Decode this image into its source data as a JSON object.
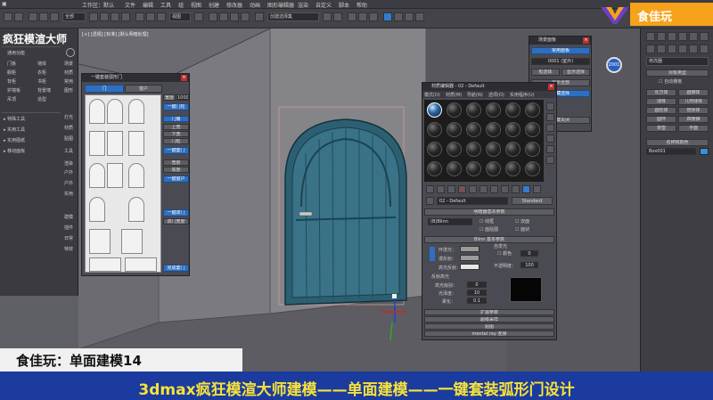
{
  "app": {
    "window_title": "工作区：默认",
    "menus": [
      "文件",
      "编辑",
      "工具",
      "组",
      "视图",
      "创建",
      "修改器",
      "动画",
      "图形编辑器",
      "渲染",
      "自定义",
      "脚本",
      "帮助"
    ],
    "selection_dropdown": "全部",
    "view_dropdown": "视图",
    "named_selection": "创建选择集"
  },
  "brand": {
    "text": "食佳玩"
  },
  "left_panel": {
    "title": "疯狂模渲大师",
    "items": [
      {
        "label": "通用功能",
        "col2": ""
      },
      {
        "label": "门板",
        "col2": "墙体"
      },
      {
        "label": "橱柜",
        "col2": "衣柜"
      },
      {
        "label": "背柜",
        "col2": "书柜"
      },
      {
        "label": "护墙板",
        "col2": "背景墙"
      },
      {
        "label": "吊顶",
        "col2": "造型"
      },
      {
        "label": "特殊工具",
        "col2": ""
      },
      {
        "label": "实用工具",
        "col2": ""
      },
      {
        "label": "实用图纸",
        "col2": ""
      },
      {
        "label": "移动面板",
        "col2": ""
      }
    ],
    "side_tabs": [
      "场景",
      "材质",
      "常用",
      "图形",
      "灯光",
      "材质",
      "贴图",
      "工具",
      "渲染",
      "户外",
      "户外",
      "实用",
      "建模",
      "插件",
      "日常",
      "特效"
    ]
  },
  "viewport": {
    "label": "[+] [透视] [标准] [默认明暗处理]"
  },
  "door_library": {
    "title": "一键套装弧形门",
    "tabs": [
      "门",
      "窗户"
    ],
    "side_labels": [
      "宽度",
      "1000",
      "一键门柱",
      "门扇",
      "上宽",
      "下宽",
      "门框",
      "一键套门",
      "宽度",
      "高度",
      "一键窗户",
      "一键双门",
      "双门宽度",
      "一键套门",
      "完成套门"
    ]
  },
  "material_editor": {
    "title": "材质编辑器 - 02 - Default",
    "menu": [
      "模式(D)",
      "材质(M)",
      "导航(N)",
      "选项(O)",
      "实用程序(U)"
    ],
    "material_name": "02 - Default",
    "material_type": "Standard",
    "rollouts": [
      "明暗器基本参数",
      "Blinn 基本参数",
      "扩展参数",
      "超级采样",
      "贴图",
      "mental ray 连接"
    ],
    "shader": "(B)Blinn",
    "options": [
      "线框",
      "双面",
      "面贴图",
      "面状"
    ],
    "params": {
      "ambient_label": "环境光：",
      "diffuse_label": "漫反射：",
      "specular_label": "高光反射：",
      "self_illum_label": "自发光",
      "color_label": "颜色",
      "color_value": "0",
      "opacity_label": "不透明度：",
      "opacity_value": "100",
      "specular_highlights": "反射高光",
      "spec_level_label": "高光级别：",
      "spec_level_value": "0",
      "glossiness_label": "光泽度：",
      "glossiness_value": "10",
      "soften_label": "柔化：",
      "soften_value": "0.1"
    }
  },
  "scene_panel": {
    "title": "场景面板",
    "label1": "常用面板",
    "field": "0001 (室外)",
    "buttons": [
      "框选体",
      "显示选择",
      "显示全部",
      "隐藏选择",
      "隐藏关闭"
    ],
    "badge": "2001"
  },
  "command_panel": {
    "dropdown": "修改器",
    "rollout_title": "对象类型",
    "auto_grid": "自动栅格",
    "object_types": [
      "长方体",
      "圆锥体",
      "球体",
      "几何球体",
      "圆柱体",
      "管状体",
      "圆环",
      "四棱锥",
      "茶壶",
      "平面"
    ],
    "name_color": "名称和颜色",
    "name_value": "Box001"
  },
  "captions": {
    "episode": "食佳玩：单面建模14",
    "subtitle": "3dmax疯狂模渲大师建模——单面建模——一键套装弧形门设计"
  }
}
